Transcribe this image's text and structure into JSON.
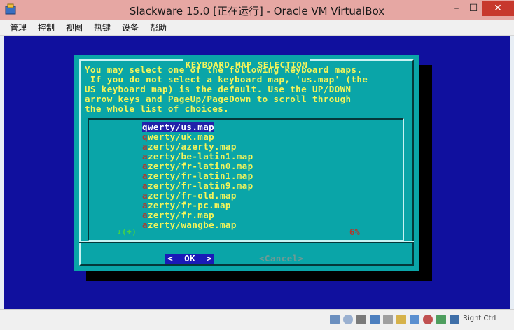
{
  "window": {
    "title": "Slackware 15.0 [正在运行] - Oracle VM VirtualBox",
    "minimize_glyph": "–",
    "maximize_glyph": "☐",
    "close_glyph": "✕",
    "app_icon": "virtualbox-icon"
  },
  "menu": {
    "items": [
      "管理",
      "控制",
      "视图",
      "热键",
      "设备",
      "帮助"
    ]
  },
  "dialog": {
    "title": "KEYBOARD MAP SELECTION",
    "prompt": "You may select one of the following keyboard maps.\n If you do not select a keyboard map, 'us.map' (the\nUS keyboard map) is the default. Use the UP/DOWN\narrow keys and PageUp/PageDown to scroll through\nthe whole list of choices.",
    "items": [
      {
        "first": "q",
        "rest": "werty/us.map"
      },
      {
        "first": "q",
        "rest": "werty/uk.map"
      },
      {
        "first": "a",
        "rest": "zerty/azerty.map"
      },
      {
        "first": "a",
        "rest": "zerty/be-latin1.map"
      },
      {
        "first": "a",
        "rest": "zerty/fr-latin0.map"
      },
      {
        "first": "a",
        "rest": "zerty/fr-latin1.map"
      },
      {
        "first": "a",
        "rest": "zerty/fr-latin9.map"
      },
      {
        "first": "a",
        "rest": "zerty/fr-old.map"
      },
      {
        "first": "a",
        "rest": "zerty/fr-pc.map"
      },
      {
        "first": "a",
        "rest": "zerty/fr.map"
      },
      {
        "first": "a",
        "rest": "zerty/wangbe.map"
      }
    ],
    "selected_index": 0,
    "scroll_indicator": "↓(+)",
    "scroll_percent": "6%",
    "ok_label": "<  OK  >",
    "cancel_label": "<Cancel>"
  },
  "statusbar": {
    "icons": [
      "hard-disk-icon",
      "optical-drive-icon",
      "audio-icon",
      "network-icon",
      "usb-icon",
      "shared-folder-icon",
      "display-icon",
      "recording-icon",
      "cpu-icon",
      "mouse-integration-icon",
      "keyboard-icon"
    ],
    "host_key_label": "Right Ctrl"
  },
  "colors": {
    "screen": "#10109e",
    "dialog": "#0aa5a8",
    "text": "#f5f55a",
    "hotkey": "#b03a2e",
    "selection": "#2222aa"
  }
}
